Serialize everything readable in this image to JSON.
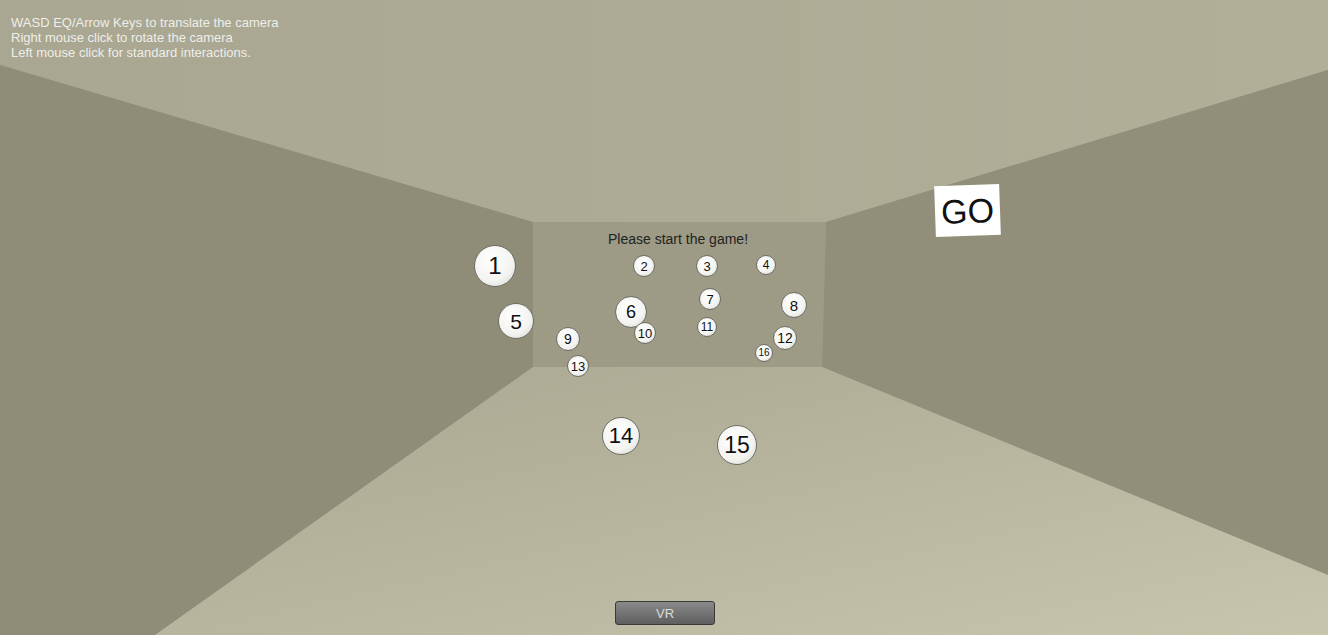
{
  "hud": {
    "instructions": [
      "WASD EQ/Arrow Keys to translate the camera",
      "Right mouse click to rotate the camera",
      "Left mouse click for standard interactions."
    ]
  },
  "scene": {
    "message": "Please start the game!",
    "balls": [
      {
        "label": "1"
      },
      {
        "label": "2"
      },
      {
        "label": "3"
      },
      {
        "label": "4"
      },
      {
        "label": "5"
      },
      {
        "label": "6"
      },
      {
        "label": "7"
      },
      {
        "label": "8"
      },
      {
        "label": "9"
      },
      {
        "label": "10"
      },
      {
        "label": "11"
      },
      {
        "label": "12"
      },
      {
        "label": "13"
      },
      {
        "label": "14"
      },
      {
        "label": "15"
      },
      {
        "label": "16"
      }
    ],
    "sign": {
      "label": "GO"
    }
  },
  "buttons": [
    {
      "label": "VR"
    }
  ]
}
